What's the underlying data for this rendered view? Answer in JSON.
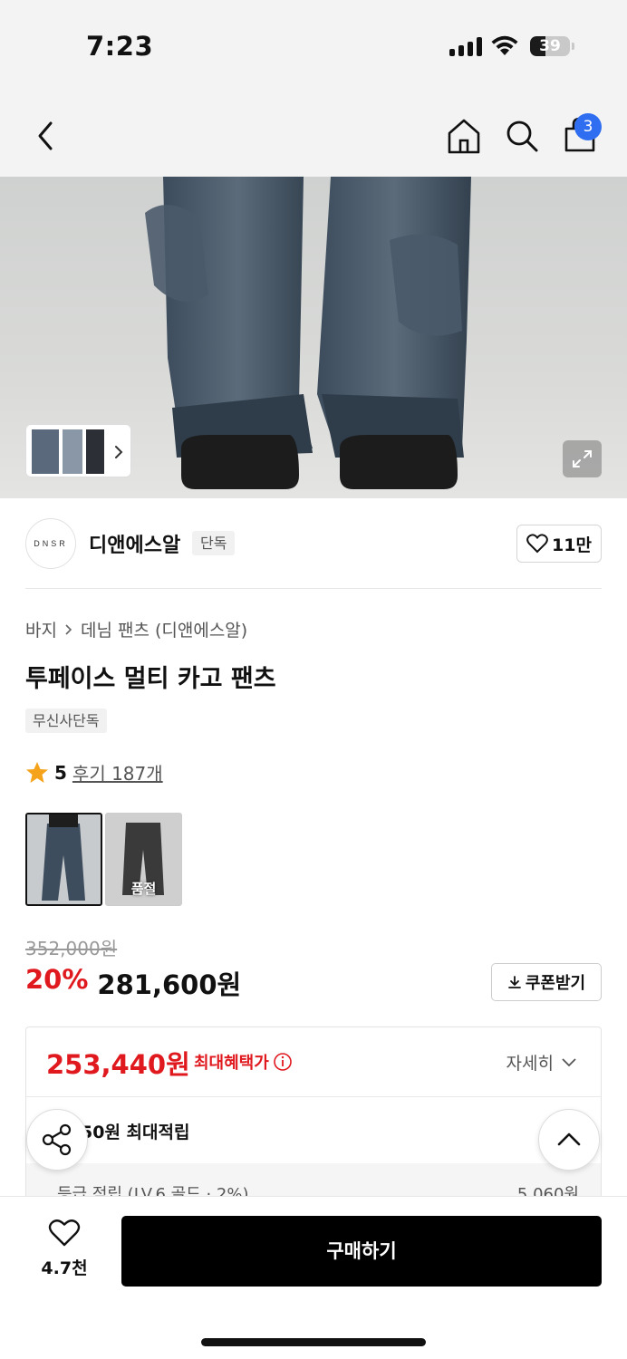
{
  "status_bar": {
    "time": "7:23",
    "battery": "39",
    "battery_level": 0.39
  },
  "nav": {
    "cart_count": "3",
    "icons": [
      "back-icon",
      "home-icon",
      "search-icon",
      "cart-icon"
    ]
  },
  "brand": {
    "logo_text": "DNSR",
    "name": "디앤에스알",
    "badge": "단독",
    "likes": "11만"
  },
  "breadcrumb": {
    "category": "바지",
    "subcategory": "데님 팬츠 (디앤에스알)"
  },
  "product": {
    "title": "투페이스 멀티 카고 팬츠",
    "tag": "무신사단독",
    "rating_score": "5",
    "reviews": "후기 187개"
  },
  "options": [
    {
      "selected": true,
      "sold_out_label": ""
    },
    {
      "selected": false,
      "sold_out_label": "품절"
    }
  ],
  "price": {
    "original": "352,000원",
    "discount": "20%",
    "sale": "281,600원",
    "coupon_label": "쿠폰받기"
  },
  "benefit": {
    "max_price": "253,440원",
    "max_label": "최대혜택가",
    "detail_label": "자세히",
    "points": "50원 최대적립",
    "grade_label": "등급 적립 (LV.6 골드 · 2%)",
    "grade_value": "5,060원"
  },
  "bottom": {
    "wish_count": "4.7천",
    "buy_label": "구매하기"
  },
  "colors": {
    "accent_red": "#e0191f",
    "badge_blue": "#2f6ef1",
    "buy_button": "#000000"
  }
}
